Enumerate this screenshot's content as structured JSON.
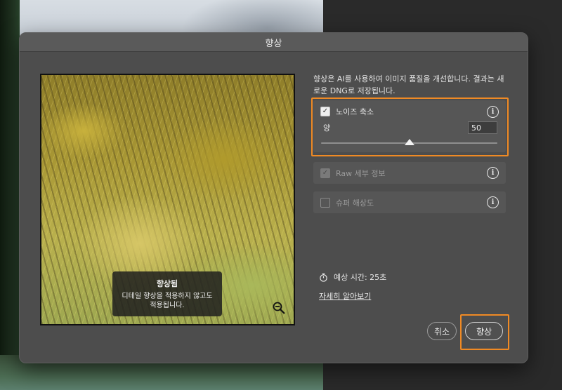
{
  "dialog": {
    "title": "향상"
  },
  "preview": {
    "overlay_title": "향상됨",
    "overlay_desc_line1": "디테일 향상을 적용하지 않고도",
    "overlay_desc_line2": "적용됩니다.",
    "zoom_icon": "zoom-out-icon"
  },
  "description": "향상은 AI를 사용하여 이미지 품질을 개선합니다. 결과는 새로운 DNG로 저장됩니다.",
  "options": {
    "noise_reduction": {
      "label": "노이즈 축소",
      "checked": true,
      "amount_label": "양",
      "amount_value": "50",
      "slider_fraction": 0.5
    },
    "raw_details": {
      "label": "Raw 세부 정보",
      "checked": true,
      "disabled": true
    },
    "super_resolution": {
      "label": "슈퍼 해상도",
      "checked": false
    },
    "info_icon": "info-icon"
  },
  "estimate": {
    "icon": "stopwatch-icon",
    "text": "예상 시간: 25초"
  },
  "learn_more": "자세히 알아보기",
  "buttons": {
    "cancel": "취소",
    "enhance": "향상"
  },
  "colors": {
    "highlight": "#f08a24",
    "dialog_bg": "#4d4d4d"
  }
}
